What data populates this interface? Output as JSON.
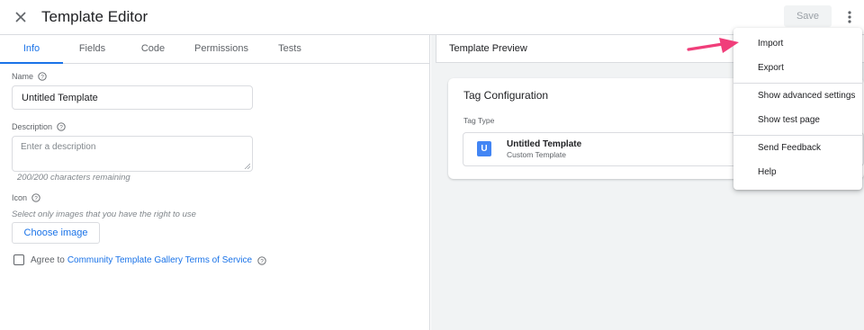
{
  "header": {
    "title": "Template Editor",
    "save_label": "Save",
    "icons": {
      "close": "close-icon",
      "more": "more-vert-icon"
    }
  },
  "tabs": [
    {
      "label": "Info",
      "active": true
    },
    {
      "label": "Fields",
      "active": false
    },
    {
      "label": "Code",
      "active": false
    },
    {
      "label": "Permissions",
      "active": false
    },
    {
      "label": "Tests",
      "active": false
    }
  ],
  "info": {
    "name_label": "Name",
    "name_value": "Untitled Template",
    "description_label": "Description",
    "description_placeholder": "Enter a description",
    "chars_remaining": "200/200 characters remaining",
    "icon_label": "Icon",
    "icon_hint": "Select only images that you have the right to use",
    "choose_image_label": "Choose image",
    "agree_prefix": "Agree to",
    "agree_link": "Community Template Gallery Terms of Service",
    "agree_checked": false
  },
  "preview": {
    "title": "Template Preview",
    "card_title": "Tag Configuration",
    "tag_type_label": "Tag Type",
    "tag_badge": "U",
    "tag_name": "Untitled Template",
    "tag_kind": "Custom Template"
  },
  "menu": {
    "items": [
      {
        "label": "Import"
      },
      {
        "label": "Export"
      },
      {
        "label": "Show advanced settings"
      },
      {
        "label": "Show test page"
      },
      {
        "label": "Send Feedback"
      },
      {
        "label": "Help"
      }
    ]
  },
  "colors": {
    "accent": "#1a73e8",
    "arrow": "#f03e7a",
    "badge": "#4285f4"
  }
}
